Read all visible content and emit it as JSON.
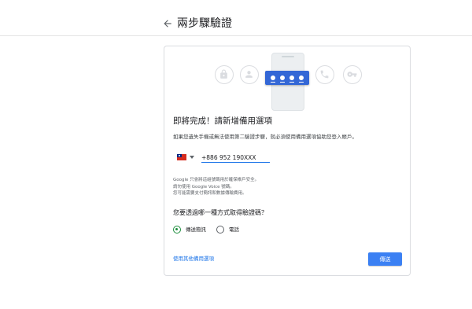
{
  "header": {
    "title": "兩步驟驗證",
    "back_icon": "arrow-back-icon"
  },
  "hero": {
    "icons": [
      "lock-icon",
      "person-icon",
      "phone-handset-icon",
      "key-icon"
    ],
    "accent_color": "#3367d6"
  },
  "card": {
    "heading": "即將完成！請新增備用選項",
    "description": "如果您遺失手機或無法使用第二驗證步驟，就必須使用備用選項協助您登入帳戶。",
    "country_flag": "taiwan-flag-icon",
    "phone_value": "+886 952 190XXX",
    "notes": [
      "Google 只會將這組號碼用於確保帳戶安全。",
      "請勿使用 Google Voice 號碼。",
      "您可能需要支付簡訊和數據傳輸費用。"
    ],
    "question": "您要透過哪一種方式取得驗證碼？",
    "options": [
      {
        "label": "傳送簡訊",
        "selected": true
      },
      {
        "label": "電話",
        "selected": false
      }
    ],
    "other_option_link": "使用其他備用選項",
    "send_button": "傳送"
  },
  "colors": {
    "primary": "#1a73e8",
    "radio_selected": "#1e8e3e",
    "button": "#3b80f3"
  }
}
